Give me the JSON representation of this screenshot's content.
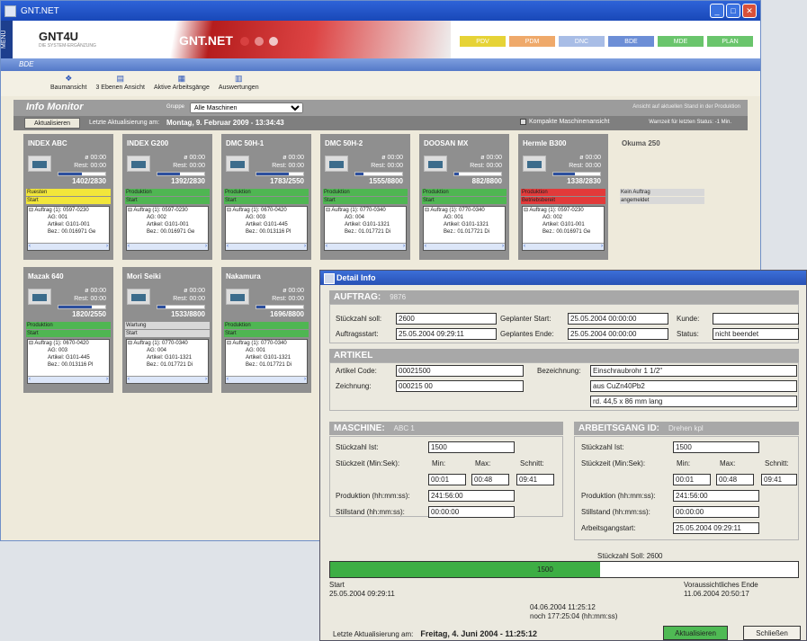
{
  "window": {
    "title": "GNT.NET"
  },
  "banner": {
    "menu": "MENU",
    "logo": "GNT4U",
    "logo_sub": "DIE SYSTEM-ERGÄNZUNG",
    "product": "GNT.NET",
    "modules": [
      {
        "label": "PDV",
        "color": "#e6d336"
      },
      {
        "label": "PDM",
        "color": "#efa96a"
      },
      {
        "label": "DNC",
        "color": "#a8bde6"
      },
      {
        "label": "BDE",
        "color": "#6c8ed6"
      },
      {
        "label": "MDE",
        "color": "#6ac56c"
      },
      {
        "label": "PLAN",
        "color": "#6ac56c"
      }
    ]
  },
  "section": "BDE",
  "toolbar": [
    {
      "label": "Baumansicht",
      "icon": "tree-icon"
    },
    {
      "label": "3 Ebenen Ansicht",
      "icon": "levels-icon"
    },
    {
      "label": "Aktive Arbeitsgänge",
      "icon": "tasks-icon"
    },
    {
      "label": "Auswertungen",
      "icon": "chart-icon"
    }
  ],
  "monitor": {
    "title": "Info Monitor",
    "group_label": "Gruppe",
    "group_value": "Alle Maschinen",
    "view_note": "Ansicht auf aktuellen Stand in der Produktion",
    "refresh": "Aktualisieren",
    "last_update_label": "Letzte Aktualisierung am:",
    "last_update": "Montag, 9. Februar 2009 - 13:34:43",
    "compact": "Kompakte Maschinenansicht",
    "warn": "Warnzeit für letzten Status: -1 Min."
  },
  "machines": [
    {
      "name": "INDEX ABC",
      "t1": "ø 00:00",
      "t2": "Rest: 00:00",
      "count": "1402/2830",
      "progress": 0.5,
      "s1": "Ruesten",
      "s1c": "#f2e63a",
      "s2": "Start",
      "s2c": "#f2e63a",
      "l1": "⊟ Auftrag (1): 0597-0230",
      "l2": "AG: 001",
      "l3": "Artikel: G101-001",
      "l4": "Bez.: 00.016971 Ge"
    },
    {
      "name": "INDEX G200",
      "t1": "ø 00:00",
      "t2": "Rest: 00:00",
      "count": "1392/2830",
      "progress": 0.49,
      "s1": "Produktion",
      "s1c": "#4fb652",
      "s2": "Start",
      "s2c": "#4fb652",
      "l1": "⊟ Auftrag (1): 0597-0230",
      "l2": "AG: 002",
      "l3": "Artikel: G101-001",
      "l4": "Bez.: 00.016971 Ge"
    },
    {
      "name": "DMC 50H-1",
      "t1": "ø 00:00",
      "t2": "Rest: 00:00",
      "count": "1783/2550",
      "progress": 0.7,
      "s1": "Produktion",
      "s1c": "#4fb652",
      "s2": "Start",
      "s2c": "#4fb652",
      "l1": "⊟ Auftrag (1): 0670-0420",
      "l2": "AG: 003",
      "l3": "Artikel: G101-445",
      "l4": "Bez.: 00.013116 Pl"
    },
    {
      "name": "DMC 50H-2",
      "t1": "ø 00:00",
      "t2": "Rest: 00:00",
      "count": "1555/8800",
      "progress": 0.18,
      "s1": "Produktion",
      "s1c": "#4fb652",
      "s2": "Start",
      "s2c": "#4fb652",
      "l1": "⊟ Auftrag (1): 0770-0340",
      "l2": "AG: 004",
      "l3": "Artikel: G101-1321",
      "l4": "Bez.: 01.017721 Di"
    },
    {
      "name": "DOOSAN MX",
      "t1": "ø 00:00",
      "t2": "Rest: 00:00",
      "count": "882/8800",
      "progress": 0.1,
      "s1": "Produktion",
      "s1c": "#4fb652",
      "s2": "Start",
      "s2c": "#4fb652",
      "l1": "⊟ Auftrag (1): 0770-0340",
      "l2": "AG: 001",
      "l3": "Artikel: G101-1321",
      "l4": "Bez.: 01.017721 Di"
    },
    {
      "name": "Hermle B300",
      "t1": "ø 00:00",
      "t2": "Rest: 00:00",
      "count": "1338/2830",
      "progress": 0.47,
      "s1": "Produktion",
      "s1c": "#e23a3a",
      "s2": "Betriebsbereit",
      "s2c": "#e23a3a",
      "l1": "⊟ Auftrag (1): 0597-0230",
      "l2": "AG: 002",
      "l3": "Artikel: G101-001",
      "l4": "Bez.: 00.016971 Ge"
    },
    {
      "name": "Okuma 250",
      "empty": true,
      "s1": "Kein Auftrag",
      "s2": "angemeldet"
    },
    {
      "name": "Mazak 640",
      "t1": "ø 00:00",
      "t2": "Rest: 00:00",
      "count": "1820/2550",
      "progress": 0.71,
      "s1": "Produktion",
      "s1c": "#4fb652",
      "s2": "Start",
      "s2c": "#4fb652",
      "l1": "⊟ Auftrag (1): 0670-0420",
      "l2": "AG: 003",
      "l3": "Artikel: G101-445",
      "l4": "Bez.: 00.013116 Pl"
    },
    {
      "name": "Mori Seiki",
      "t1": "ø 00:00",
      "t2": "Rest: 00:00",
      "count": "1533/8800",
      "progress": 0.17,
      "s1": "Wartung",
      "s1c": "#d8d8d8",
      "s2": "Start",
      "s2c": "#d8d8d8",
      "l1": "⊟ Auftrag (1): 0770-0340",
      "l2": "AG: 004",
      "l3": "Artikel: G101-1321",
      "l4": "Bez.: 01.017721 Di"
    },
    {
      "name": "Nakamura",
      "t1": "ø 00:00",
      "t2": "Rest: 00:00",
      "count": "1696/8800",
      "progress": 0.19,
      "s1": "Produktion",
      "s1c": "#4fb652",
      "s2": "Start",
      "s2c": "#4fb652",
      "l1": "⊟ Auftrag (1): 0770-0340",
      "l2": "AG: 001",
      "l3": "Artikel: G101-1321",
      "l4": "Bez.: 01.017721 Di"
    }
  ],
  "detail": {
    "title": "Detail Info",
    "auftrag": {
      "header": "AUFTRAG:",
      "number": "9876",
      "soll_l": "Stückzahl soll:",
      "soll": "2600",
      "start_l": "Auftragsstart:",
      "start": "25.05.2004 09:29:11",
      "gstart_l": "Geplanter Start:",
      "gstart": "25.05.2004 00:00:00",
      "gend_l": "Geplantes Ende:",
      "gend": "25.05.2004 00:00:00",
      "kunde_l": "Kunde:",
      "kunde": "",
      "status_l": "Status:",
      "status": "nicht beendet"
    },
    "artikel": {
      "header": "ARTIKEL",
      "code_l": "Artikel Code:",
      "code": "00021500",
      "zeich_l": "Zeichnung:",
      "zeich": "000215 00",
      "bez_l": "Bezeichnung:",
      "bez1": "Einschraubrohr 1 1/2\"",
      "bez2": "aus CuZn40Pb2",
      "bez3": "rd. 44,5 x 86 mm lang"
    },
    "maschine": {
      "header": "MASCHINE:",
      "value": "ABC 1",
      "ist_l": "Stückzahl Ist:",
      "ist": "1500",
      "zeit_l": "Stückzeit (Min:Sek):",
      "min_l": "Min:",
      "max_l": "Max:",
      "schnitt_l": "Schnitt:",
      "min": "00:01",
      "max": "00:48",
      "schnitt": "09:41",
      "prod_l": "Produktion (hh:mm:ss):",
      "prod": "241:56:00",
      "still_l": "Stillstand (hh:mm:ss):",
      "still": "00:00:00"
    },
    "arbeitsgang": {
      "header": "ARBEITSGANG ID:",
      "value": "Drehen kpl",
      "ist_l": "Stückzahl Ist:",
      "ist": "1500",
      "zeit_l": "Stückzeit (Min:Sek):",
      "min_l": "Min:",
      "max_l": "Max:",
      "schnitt_l": "Schnitt:",
      "min": "00:01",
      "max": "00:48",
      "schnitt": "09:41",
      "prod_l": "Produktion (hh:mm:ss):",
      "prod": "241:56:00",
      "still_l": "Stillstand (hh:mm:ss):",
      "still": "00:00:00",
      "start_l": "Arbeitsgangstart:",
      "start": "25.05.2004 09:29:11"
    },
    "progress": {
      "soll_l": "Stückzahl Soll: 2600",
      "current": "1500",
      "fraction": 0.577,
      "start_l": "Start",
      "start": "25.05.2004 09:29:11",
      "mid1": "04.06.2004 11:25:12",
      "mid2": "noch 177:25:04 (hh:mm:ss)",
      "end_l": "Voraussichtliches Ende",
      "end": "11.06.2004 20:50:17"
    },
    "footer": {
      "label": "Letzte Aktualisierung am:",
      "date": "Freitag, 4. Juni 2004 - 11:25:12",
      "refresh": "Aktualisieren",
      "close": "Schließen"
    }
  }
}
